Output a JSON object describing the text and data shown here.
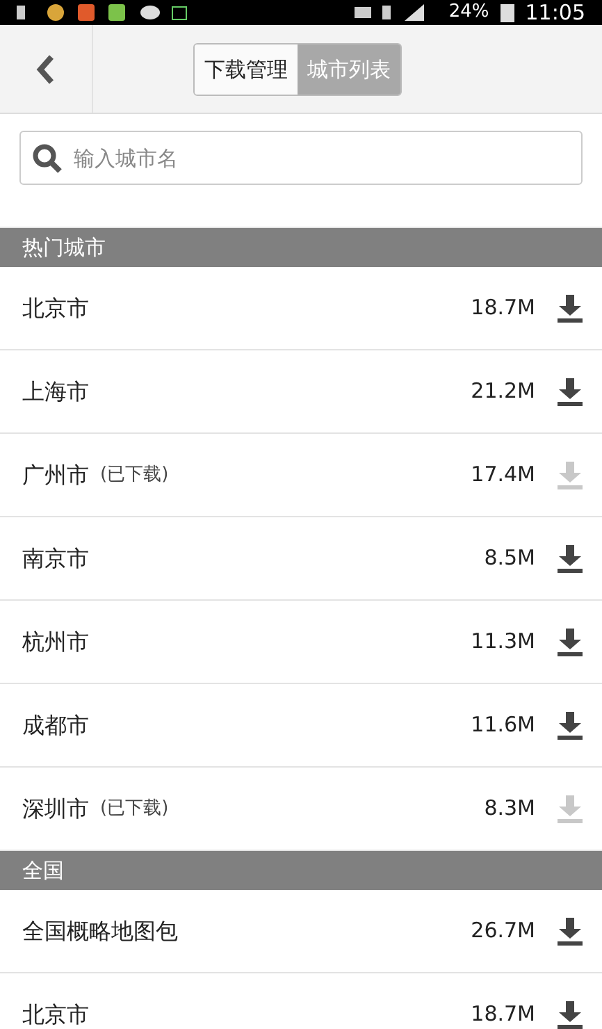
{
  "status_bar": {
    "battery": "24%",
    "time": "11:05"
  },
  "header": {
    "tabs": [
      {
        "label": "下载管理",
        "selected": false
      },
      {
        "label": "城市列表",
        "selected": true
      }
    ]
  },
  "search": {
    "placeholder": "输入城市名"
  },
  "sections": [
    {
      "title": "热门城市",
      "rows": [
        {
          "name": "北京市",
          "size": "18.7M",
          "downloaded": false
        },
        {
          "name": "上海市",
          "size": "21.2M",
          "downloaded": false
        },
        {
          "name": "广州市",
          "note": "(已下载)",
          "size": "17.4M",
          "downloaded": true
        },
        {
          "name": "南京市",
          "size": "8.5M",
          "downloaded": false
        },
        {
          "name": "杭州市",
          "size": "11.3M",
          "downloaded": false
        },
        {
          "name": "成都市",
          "size": "11.6M",
          "downloaded": false
        },
        {
          "name": "深圳市",
          "note": "(已下载)",
          "size": "8.3M",
          "downloaded": true
        }
      ]
    },
    {
      "title": "全国",
      "rows": [
        {
          "name": "全国概略地图包",
          "size": "26.7M",
          "downloaded": false
        },
        {
          "name": "北京市",
          "size": "18.7M",
          "downloaded": false
        }
      ]
    }
  ]
}
